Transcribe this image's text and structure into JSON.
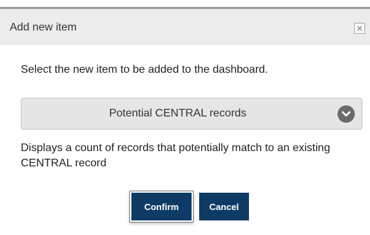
{
  "dialog": {
    "title": "Add new item",
    "close_icon": "close-icon",
    "prompt": "Select the new item to be added to the dashboard.",
    "select": {
      "selected_value": "Potential CENTRAL records",
      "icon": "chevron-down-circle-icon"
    },
    "description": "Displays a count of records that potentially match to an existing CENTRAL record",
    "buttons": {
      "confirm_label": "Confirm",
      "cancel_label": "Cancel"
    }
  },
  "colors": {
    "header_background": "#ececec",
    "button_primary": "#0d3b66",
    "select_background": "#e6e6e6",
    "chevron_circle": "#6b6b6b"
  }
}
